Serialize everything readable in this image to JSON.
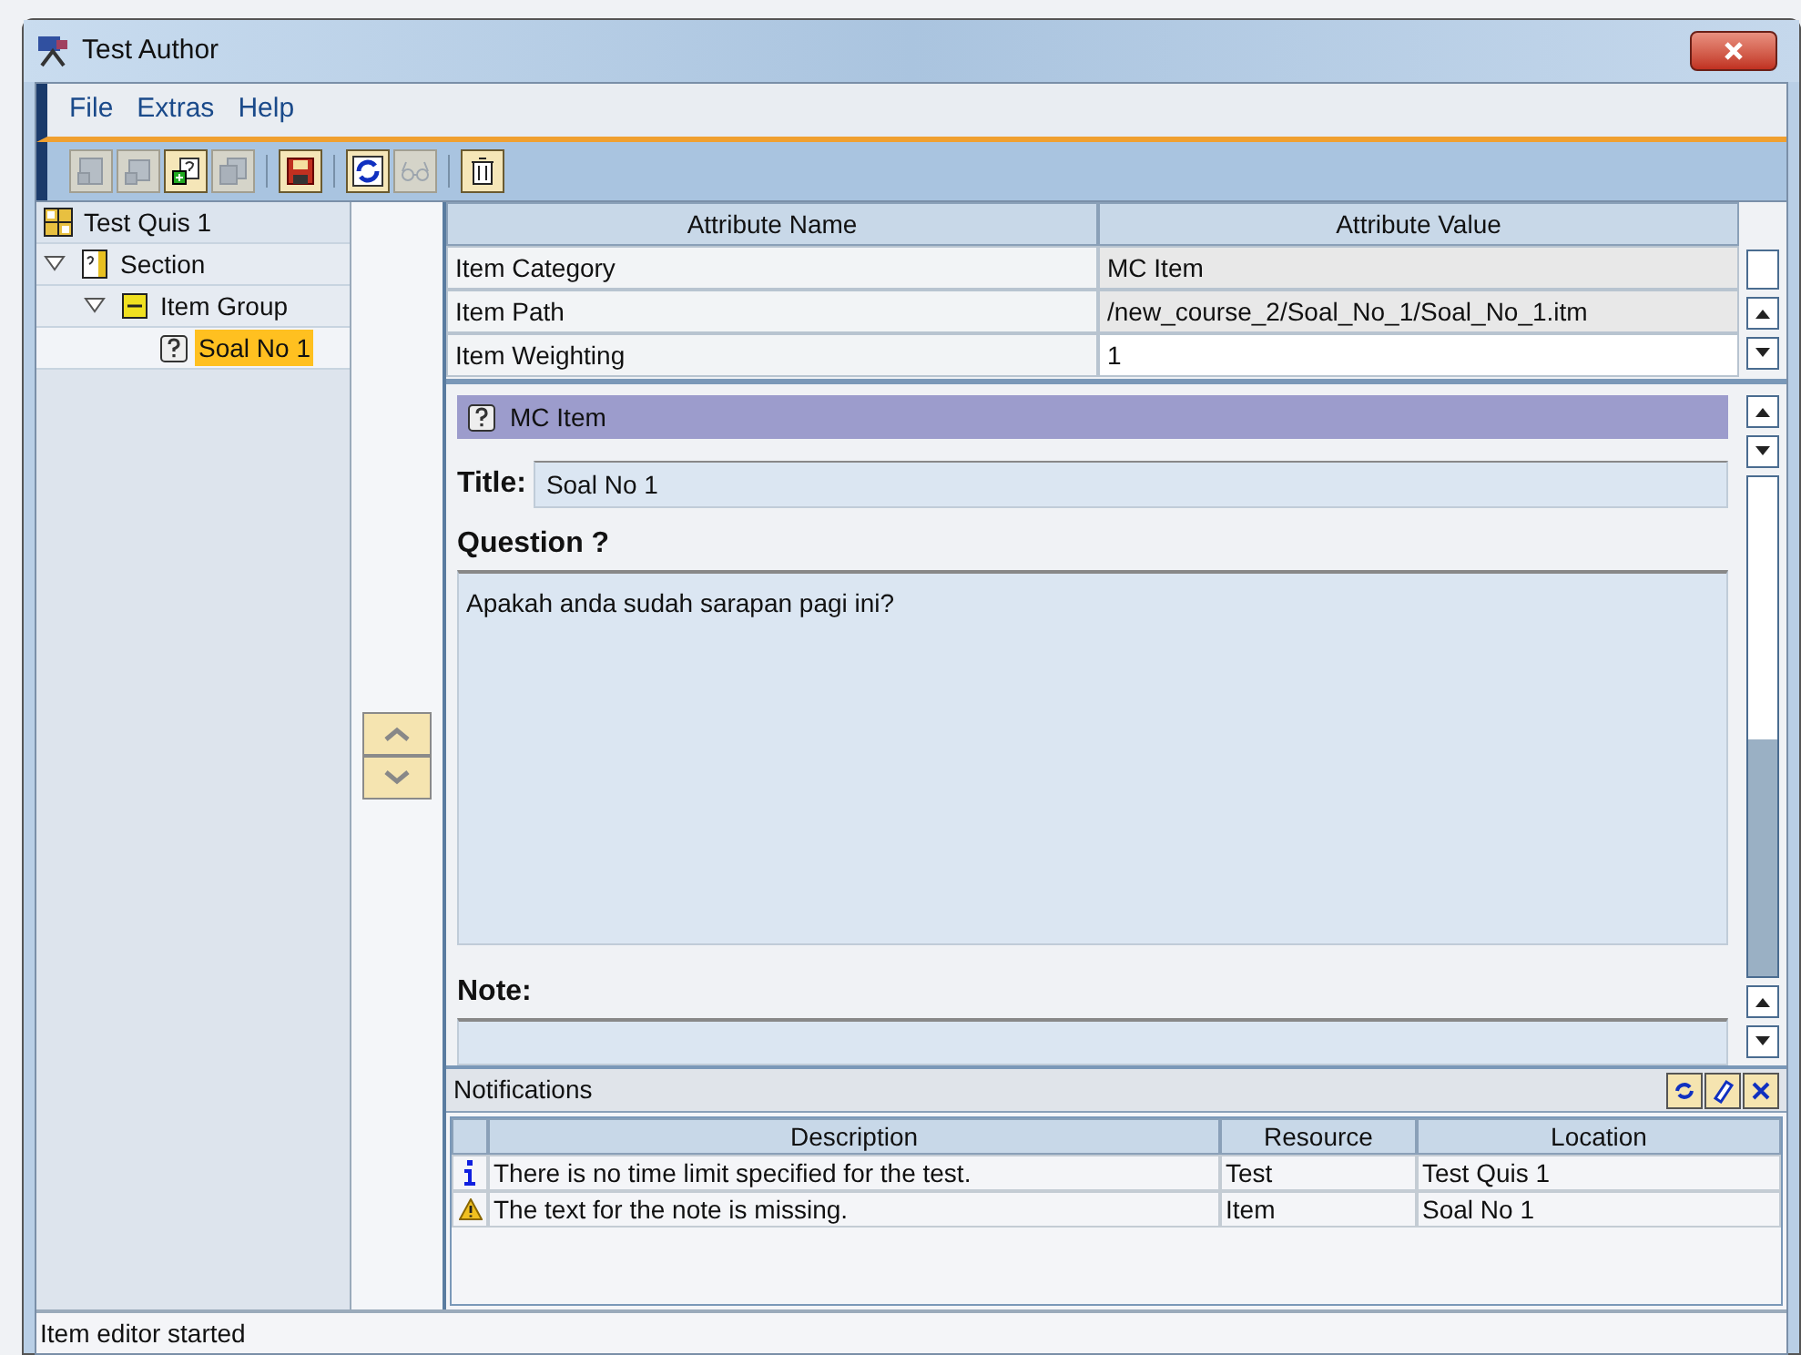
{
  "window": {
    "title": "Test Author"
  },
  "menu": [
    "File",
    "Extras",
    "Help"
  ],
  "toolbar": [
    {
      "kind": "add-section",
      "disabled": true
    },
    {
      "kind": "add-group",
      "disabled": true
    },
    {
      "kind": "add-item",
      "disabled": false
    },
    {
      "kind": "copy",
      "disabled": true
    },
    {
      "kind": "sep"
    },
    {
      "kind": "save",
      "disabled": false
    },
    {
      "kind": "sep"
    },
    {
      "kind": "refresh",
      "disabled": false
    },
    {
      "kind": "preview",
      "disabled": true
    },
    {
      "kind": "sep"
    },
    {
      "kind": "delete",
      "disabled": false
    }
  ],
  "tree": [
    {
      "label": "Test Quis 1",
      "kind": "test",
      "selected": false,
      "children": [
        {
          "label": "Section",
          "kind": "section",
          "expanded": true,
          "selected": false,
          "children": [
            {
              "label": "Item Group",
              "kind": "group",
              "expanded": true,
              "selected": false,
              "children": [
                {
                  "label": "Soal No 1",
                  "kind": "item",
                  "selected": true
                }
              ]
            }
          ]
        }
      ]
    }
  ],
  "attributes": {
    "columns": [
      "Attribute Name",
      "Attribute Value"
    ],
    "rows": [
      {
        "name": "Item Category",
        "value": "MC Item",
        "editable": false
      },
      {
        "name": "Item Path",
        "value": "/new_course_2/Soal_No_1/Soal_No_1.itm",
        "editable": false
      },
      {
        "name": "Item Weighting",
        "value": "1",
        "editable": true
      }
    ]
  },
  "editor": {
    "header": "MC Item",
    "title_label": "Title:",
    "title": "Soal No 1",
    "question_label": "Question ?",
    "question": "Apakah anda sudah sarapan pagi ini?",
    "note_label": "Note:"
  },
  "notifications": {
    "title": "Notifications",
    "columns": [
      "Description",
      "Resource",
      "Location"
    ],
    "rows": [
      {
        "kind": "info",
        "description": "There is no time limit specified for the test.",
        "resource": "Test",
        "location": "Test Quis 1"
      },
      {
        "kind": "warning",
        "description": "The text for the note is missing.",
        "resource": "Item",
        "location": "Soal No 1"
      }
    ]
  },
  "status_bar": "Item editor started"
}
